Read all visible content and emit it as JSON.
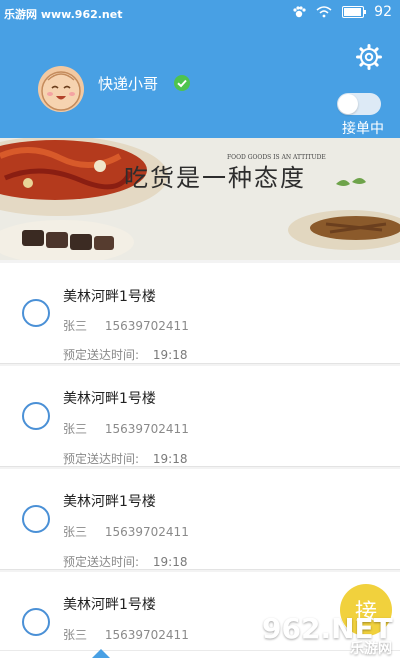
{
  "status": {
    "watermark_top": "乐游网 www.962.net",
    "battery_pct": "92",
    "battery_level": 0.92
  },
  "header": {
    "courier_name": "快递小哥",
    "accepting_label": "接单中",
    "accepting_on": true,
    "colors": {
      "bg": "#48a0e4",
      "verified": "#4ec34e"
    },
    "icons": [
      "gear-icon",
      "verified-check-icon",
      "paw-icon",
      "wifi-icon",
      "battery-icon"
    ]
  },
  "banner": {
    "slogan": "吃货是一种态度",
    "slogan_sub": "FOOD GOODS IS AN ATTITUDE"
  },
  "orders": [
    {
      "address": "美林河畔1号楼",
      "name": "张三",
      "phone": "15639702411",
      "eta_label": "预定送达时间:",
      "eta_time": "19:18"
    },
    {
      "address": "美林河畔1号楼",
      "name": "张三",
      "phone": "15639702411",
      "eta_label": "预定送达时间:",
      "eta_time": "19:18"
    },
    {
      "address": "美林河畔1号楼",
      "name": "张三",
      "phone": "15639702411",
      "eta_label": "预定送达时间:",
      "eta_time": "19:18"
    },
    {
      "address": "美林河畔1号楼",
      "name": "张三",
      "phone": "15639702411"
    }
  ],
  "fab": {
    "label": "接",
    "color": "#f1d13d"
  },
  "watermark": {
    "text": "962.NET",
    "sub": "乐游网"
  }
}
